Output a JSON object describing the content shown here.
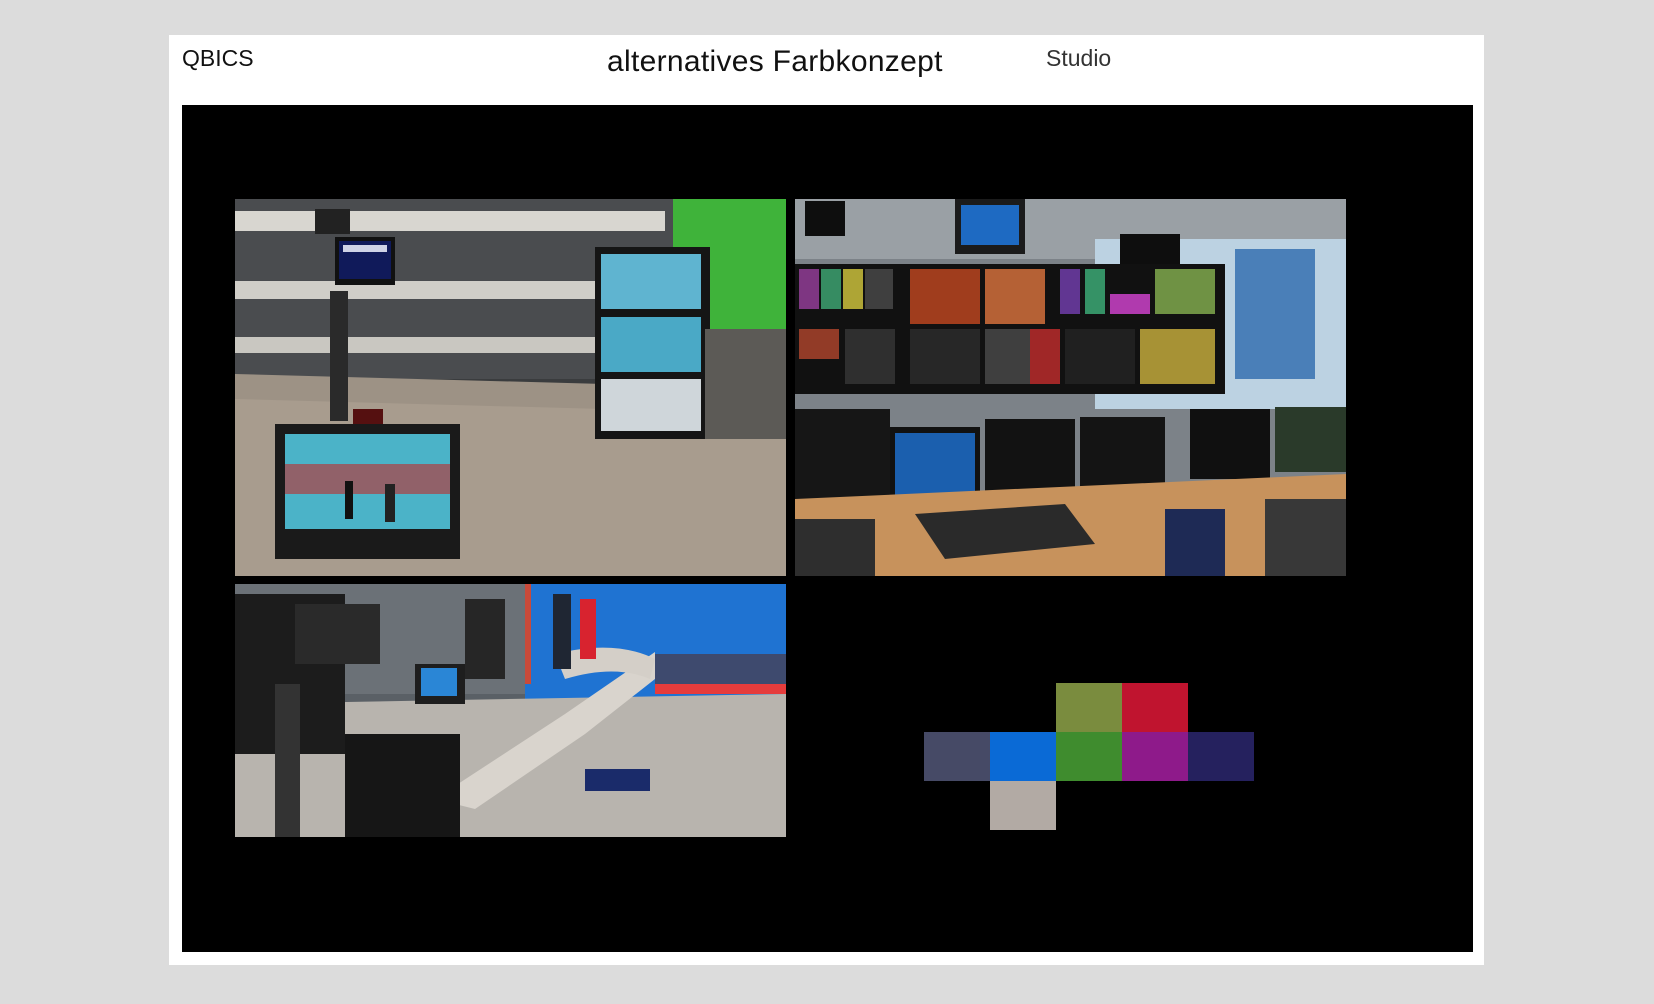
{
  "header": {
    "left": "QBICS",
    "title": "alternatives Farbkonzept",
    "right": "Studio"
  },
  "photos": [
    {
      "subject": "studio-floor-monitors-green-screen"
    },
    {
      "subject": "control-room-multiviewer-desk"
    },
    {
      "subject": "news-studio-camera-and-anchors"
    }
  ],
  "palette": {
    "row1": [
      "#7a8c3e",
      "#c0142f"
    ],
    "row2": [
      "#464a66",
      "#0a6ad6",
      "#3f8c2e",
      "#8e1a8a",
      "#25215e"
    ],
    "row3": [
      "#b2aaa4"
    ]
  }
}
